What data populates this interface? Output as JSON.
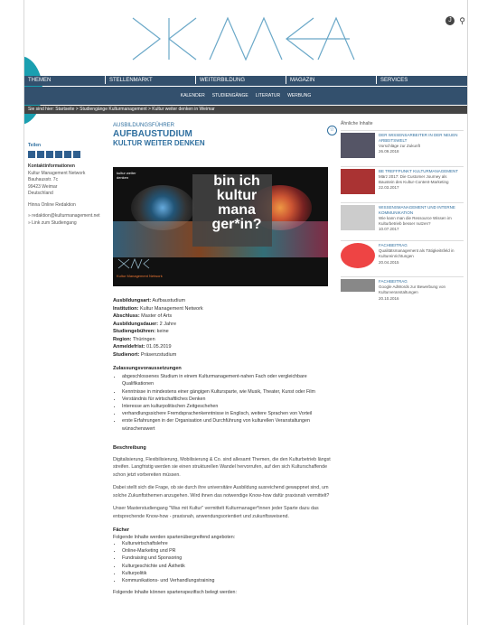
{
  "header": {
    "avatar_initial": "J",
    "accent_circle_color": "#1a9fb0"
  },
  "nav": {
    "main": [
      "THEMEN",
      "STELLENMARKT",
      "WEITERBILDUNG",
      "MAGAZIN",
      "SERVICES"
    ],
    "sub": [
      "KALENDER",
      "STUDIENGÄNGE",
      "LITERATUR",
      "WERBUNG"
    ],
    "bar_color": "#33506d"
  },
  "breadcrumb": "Sie sind hier: Startseite > Studiengänge Kulturmanagement > Kultur weiter denken in Weimar",
  "left": {
    "teilen": "Teilen",
    "contact_title": "Kontaktinformationen",
    "contact_lines": [
      "Kultur Management Network",
      "Bauhausstr. 7c",
      "99423 Weimar",
      "Deutschland"
    ],
    "online_link": "Hinna Online Redaktion",
    "email": "» redaktion@kulturmanagement.net",
    "study_link": "» Link zum Studiengang"
  },
  "article": {
    "kicker": "AUSBILDUNGSFÜHRER",
    "title": "AUFBAUSTUDIUM",
    "subtitle": "KULTUR WEITER DENKEN",
    "hero_small": "kultur weiter denken",
    "hero_big": "bin ich kultur mana ger*in?",
    "hero_brand": "Kultur Management Network",
    "facts": [
      {
        "k": "Ausbildungsart:",
        "v": " Aufbaustudium"
      },
      {
        "k": "Institution:",
        "v": " Kultur Management Network"
      },
      {
        "k": "Abschluss:",
        "v": " Master of Arts"
      },
      {
        "k": "Ausbildungsdauer:",
        "v": " 2 Jahre"
      },
      {
        "k": "Studiengebühren:",
        "v": " keine"
      },
      {
        "k": "Region:",
        "v": " Thüringen"
      },
      {
        "k": "Anmeldefrist:",
        "v": " 01.05.2019"
      },
      {
        "k": "Studienort:",
        "v": " Präsenzstudium"
      }
    ],
    "req_title": "Zulassungsvoraussetzungen",
    "requirements": [
      "abgeschlossenes Studium in einem Kulturmanagement-nahen Fach oder vergleichbare Qualifikationen",
      "Kenntnisse in mindestens einer gängigen Kultursparte, wie Musik, Theater, Kunst oder Film",
      "Verständnis für wirtschaftliches Denken",
      "Interesse am kulturpolitischen Zeitgeschehen",
      "verhandlungssichere Fremdsprachenkenntnisse in Englisch, weitere Sprachen von Vorteil",
      "erste Erfahrungen in der Organisation und Durchführung von kulturellen Veranstaltungen wünschenswert"
    ],
    "desc_title": "Beschreibung",
    "desc_paras": [
      "Digitalisierung, Flexibilisierung, Mobilisierung & Co. sind allesamt Themen, die den Kulturbetrieb längst streifen. Langfristig werden sie einen strukturellen Wandel hervorrufen, auf den sich Kulturschaffende schon jetzt vorbereiten müssen.",
      "Dabei stellt sich die Frage, ob sie durch ihre universitäre Ausbildung ausreichend gewappnet sind, um solche Zukunftsthemen anzugehen. Wird ihnen das notwendige Know-how dafür praxisnah vermittelt?",
      "Unser Masterstudiengang \"Was mit Kultur\" vermittelt Kulturmanager*innen jeder Sparte dazu das entsprechende Know-how - praxisnah, anwendungsorientiert und zukunftsweisend."
    ],
    "subjects_title": "Fächer",
    "subjects_intro": "Folgende Inhalte werden spartenübergreifend angeboten:",
    "subjects": [
      "Kulturwirtschaftslehre",
      "Online-Marketing und PR",
      "Fundraising und Sponsoring",
      "Kulturgeschichte und Ästhetik",
      "Kulturpolitik",
      "Kommunikations- und Verhandlungstraining"
    ],
    "subjects_more": "Folgende Inhalte können spartenspezifisch belegt werden:"
  },
  "related": {
    "header": "Ähnliche Inhalte",
    "items": [
      {
        "cat": "DER WISSENSARBEITER IN DER NEUEN ARBEITSWELT",
        "text": "Vorschläge zur Zukunft",
        "date": "26.09.2018",
        "color": "#556"
      },
      {
        "cat": "BE TREFFPUNKT KULTURMANAGEMENT",
        "text": "März 2017: Die Customer Journey als Baustein des Kultur-Content-Marketing",
        "date": "22.03.2017",
        "color": "#a33"
      },
      {
        "cat": "WISSENSMANAGEMENT UND INTERNE KOMMUNIKATION",
        "text": "Wie kann man die Ressource Wissen im Kulturbetrieb besser nutzen?",
        "date": "10.07.2017",
        "color": "#ccc"
      },
      {
        "cat": "FACHBEITRAG",
        "text": "Qualitätsmanagement als Tätigkeitsfeld in Kultureinrichtungen",
        "date": "20.04.2015",
        "color": "#e44"
      },
      {
        "cat": "FACHBEITRAG",
        "text": "Google AdWords zur Bewerbung von Kulturveranstaltungen",
        "date": "20.10.2016",
        "color": "#888"
      }
    ]
  }
}
